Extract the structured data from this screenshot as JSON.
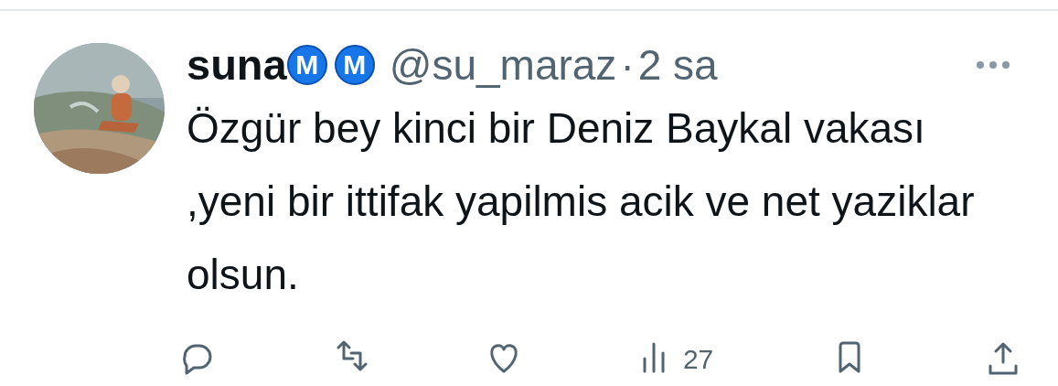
{
  "tweet": {
    "name": "suna",
    "badges": [
      "M",
      "M"
    ],
    "handle": "@su_maraz",
    "separator": "·",
    "time": "2 sa",
    "text": "Özgür bey kinci bir Deniz Baykal vakası ,yeni bir ittifak yapilmis acik ve net yaziklar olsun.",
    "actions": [
      {
        "kind": "reply"
      },
      {
        "kind": "retweet"
      },
      {
        "kind": "like"
      },
      {
        "kind": "views",
        "count": "27"
      },
      {
        "kind": "bookmark"
      },
      {
        "kind": "share"
      }
    ]
  }
}
